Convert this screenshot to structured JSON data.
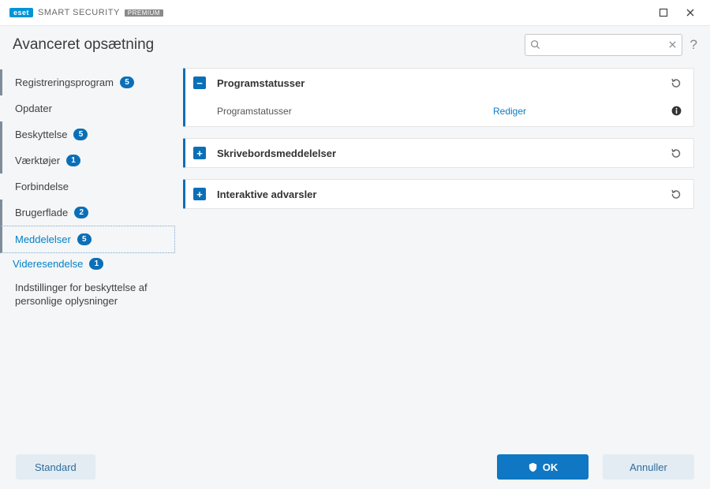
{
  "brand": {
    "badge": "eset",
    "name": "SMART SECURITY",
    "edition": "PREMIUM"
  },
  "page_title": "Avanceret opsætning",
  "search": {
    "placeholder": ""
  },
  "sidebar": {
    "items": [
      {
        "label": "Registreringsprogram",
        "badge": "5"
      },
      {
        "label": "Opdater",
        "badge": null
      },
      {
        "label": "Beskyttelse",
        "badge": "5"
      },
      {
        "label": "Værktøjer",
        "badge": "1"
      },
      {
        "label": "Forbindelse",
        "badge": null
      },
      {
        "label": "Brugerflade",
        "badge": "2"
      },
      {
        "label": "Meddelelser",
        "badge": "5"
      },
      {
        "label": "Indstillinger for beskyttelse af personlige oplysninger",
        "badge": null
      }
    ],
    "sub": [
      {
        "label": "Videresendelse",
        "badge": "1"
      }
    ]
  },
  "panels": [
    {
      "expanded": true,
      "title": "Programstatusser",
      "rows": [
        {
          "label": "Programstatusser",
          "action": "Rediger"
        }
      ]
    },
    {
      "expanded": false,
      "title": "Skrivebordsmeddelelser"
    },
    {
      "expanded": false,
      "title": "Interaktive advarsler"
    }
  ],
  "footer": {
    "standard": "Standard",
    "ok": "OK",
    "cancel": "Annuller"
  },
  "icons": {
    "expand_plus": "+",
    "expand_minus": "−"
  }
}
